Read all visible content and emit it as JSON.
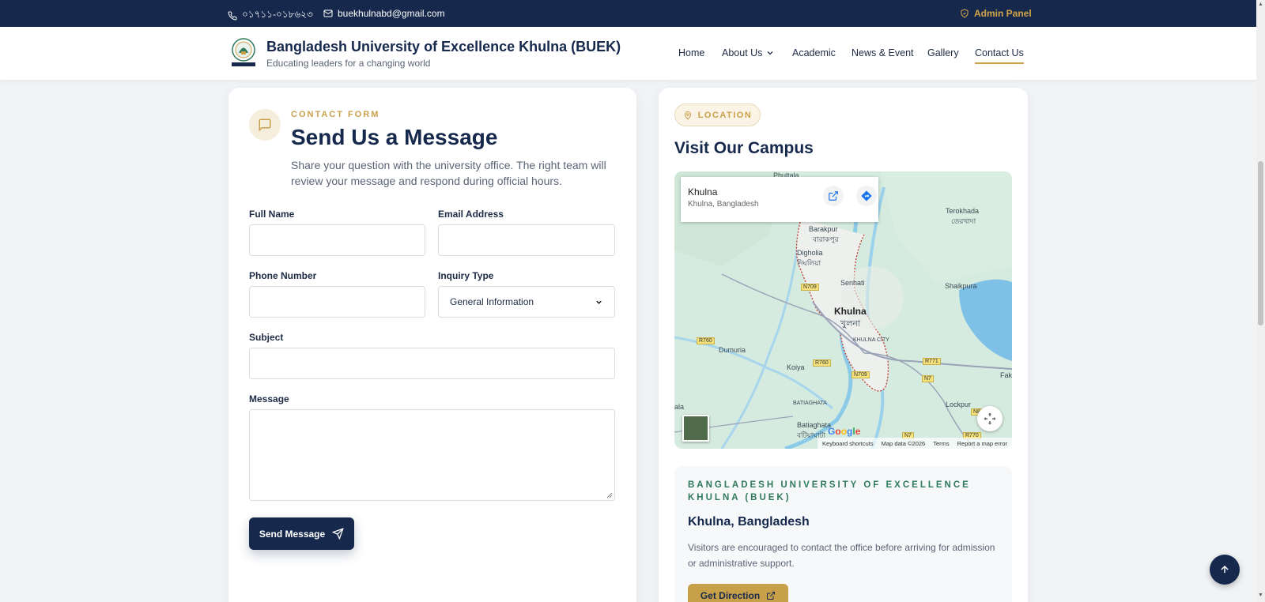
{
  "topbar": {
    "phone": "০১৭১১-০১৮৬২৩",
    "email": "buekhulnabd@gmail.com",
    "admin_label": "Admin Panel"
  },
  "header": {
    "brand_title": "Bangladesh University of Excellence Khulna (BUEK)",
    "brand_subtitle": "Educating leaders for a changing world",
    "nav": [
      {
        "label": "Home"
      },
      {
        "label": "About Us"
      },
      {
        "label": "Academic"
      },
      {
        "label": "News & Event"
      },
      {
        "label": "Gallery"
      },
      {
        "label": "Contact Us",
        "active": true
      }
    ]
  },
  "form": {
    "eyebrow": "CONTACT FORM",
    "title": "Send Us a Message",
    "description": "Share your question with the university office. The right team will review your message and respond during official hours.",
    "fields": {
      "full_name": {
        "label": "Full Name",
        "value": ""
      },
      "email": {
        "label": "Email Address",
        "value": ""
      },
      "phone": {
        "label": "Phone Number",
        "value": ""
      },
      "inquiry": {
        "label": "Inquiry Type",
        "value": "General Information"
      },
      "subject": {
        "label": "Subject",
        "value": ""
      },
      "message": {
        "label": "Message",
        "value": ""
      }
    },
    "submit_label": "Send Message"
  },
  "location": {
    "pill_label": "LOCATION",
    "title": "Visit Our Campus",
    "map": {
      "place_title": "Khulna",
      "place_subtitle": "Khulna, Bangladesh",
      "labels": {
        "phultala": "Phultala",
        "terokhada": "Terokhada",
        "terokhada_bn": "তেরখাদা",
        "barakpur": "Barakpur",
        "barakpur_bn": "বারাকপুর",
        "digholia": "Digholia",
        "digholia_bn": "দিঘলিয়া",
        "senhati": "Senhati",
        "shaikpura": "Shaikpura",
        "khulna": "Khulna",
        "khulna_bn": "খুলনা",
        "khulna_city": "KHULNA CITY",
        "dumuria": "Dumuria",
        "koiya": "Koiya",
        "fakir": "Faki",
        "batiaghata": "BATIAGHATA",
        "batiaghata2": "Batiaghata",
        "batiaghata_bn": "বটিয়াঘাটা",
        "lockpur": "Lockpur",
        "ala": "ala"
      },
      "roads": [
        "N709",
        "R760",
        "R760",
        "N709",
        "R771",
        "N7",
        "N7",
        "N805",
        "R770"
      ],
      "footer": {
        "shortcuts": "Keyboard shortcuts",
        "data": "Map data ©2026",
        "terms": "Terms",
        "report": "Report a map error"
      },
      "google": "Google"
    },
    "info": {
      "eyebrow": "BANGLADESH UNIVERSITY OF EXCELLENCE KHULNA (BUEK)",
      "title": "Khulna, Bangladesh",
      "description": "Visitors are encouraged to contact the office before arriving for admission or administrative support.",
      "direction_label": "Get Direction"
    }
  },
  "colors": {
    "navy": "#16294d",
    "gold": "#c9a04a",
    "green": "#2e7a5a"
  }
}
